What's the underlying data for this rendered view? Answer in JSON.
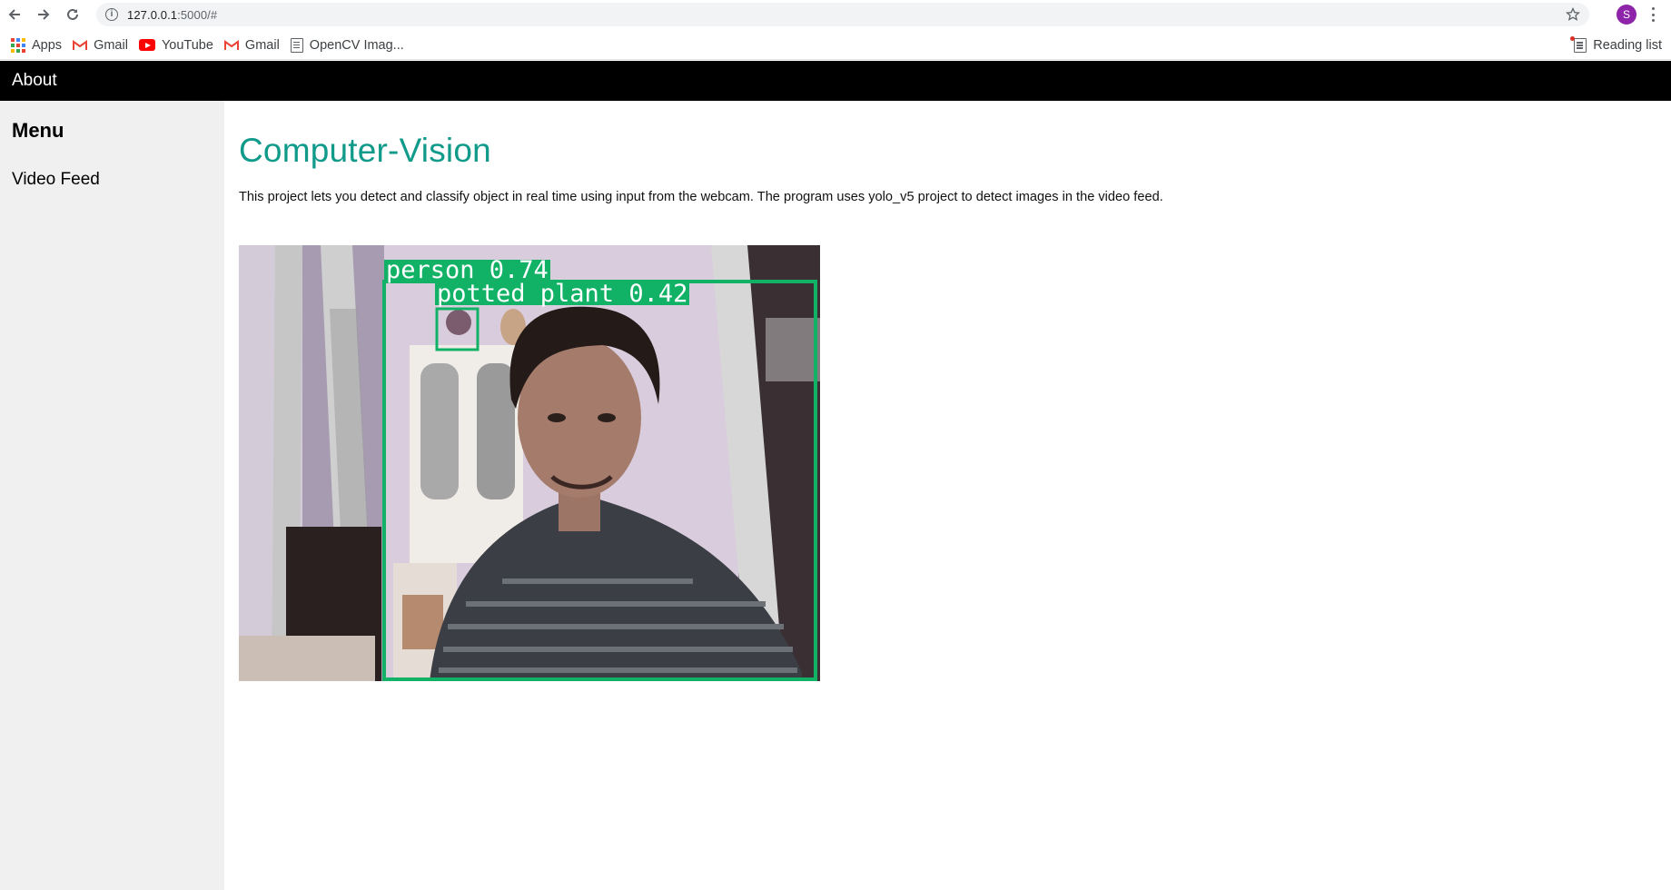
{
  "browser": {
    "url_host": "127.0.0.1",
    "url_rest": ":5000/#",
    "profile_initial": "S",
    "bookmarks": [
      {
        "label": "Apps",
        "icon": "apps-grid-icon"
      },
      {
        "label": "Gmail",
        "icon": "gmail-icon"
      },
      {
        "label": "YouTube",
        "icon": "youtube-icon"
      },
      {
        "label": "Gmail",
        "icon": "gmail-icon"
      },
      {
        "label": "OpenCV Imag...",
        "icon": "document-icon"
      }
    ],
    "reading_list": "Reading list"
  },
  "topnav": {
    "about": "About"
  },
  "sidebar": {
    "heading": "Menu",
    "items": [
      {
        "label": "Video Feed"
      }
    ]
  },
  "main": {
    "title": "Computer-Vision",
    "description": "This project lets you detect and classify object in real time using input from the webcam. The program uses yolo_v5 project to detect images in the video feed."
  },
  "video_feed": {
    "detections": [
      {
        "label": "person 0.74",
        "class": "person",
        "confidence": 0.74
      },
      {
        "label": "potted plant 0.42",
        "class": "potted plant",
        "confidence": 0.42
      }
    ],
    "box_color": "#11b266"
  },
  "colors": {
    "title": "#0f9a8a",
    "topnav": "#000000",
    "sidebar": "#f0f0f0"
  }
}
